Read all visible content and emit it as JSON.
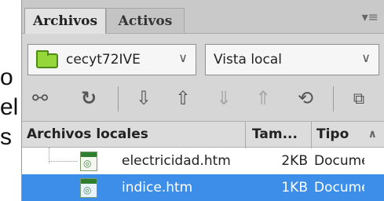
{
  "background_fragments": [
    "o",
    "el",
    "s"
  ],
  "panel": {
    "tabs": [
      {
        "label": "Archivos",
        "active": true
      },
      {
        "label": "Activos",
        "active": false
      }
    ],
    "menu_icon": "panel-menu-icon",
    "site_select": {
      "value": "cecyt72IVE",
      "icon": "folder-icon"
    },
    "view_select": {
      "value": "Vista local"
    },
    "toolbar": [
      "connect-icon",
      "refresh-icon",
      "get-files-icon",
      "put-files-icon",
      "check-out-icon",
      "check-in-icon",
      "synchronize-icon",
      "expand-icon"
    ]
  },
  "file_list": {
    "columns": [
      "Archivos locales",
      "Tam...",
      "Tipo"
    ],
    "rows": [
      {
        "name": "electricidad.htm",
        "size": "2KB",
        "type": "Documento",
        "selected": false
      },
      {
        "name": "indice.htm",
        "size": "1KB",
        "type": "Documento",
        "selected": true
      }
    ]
  },
  "colors": {
    "selection": "#3d8ee9",
    "folder": "#95d63a",
    "file_header": "#2f7e2f"
  }
}
